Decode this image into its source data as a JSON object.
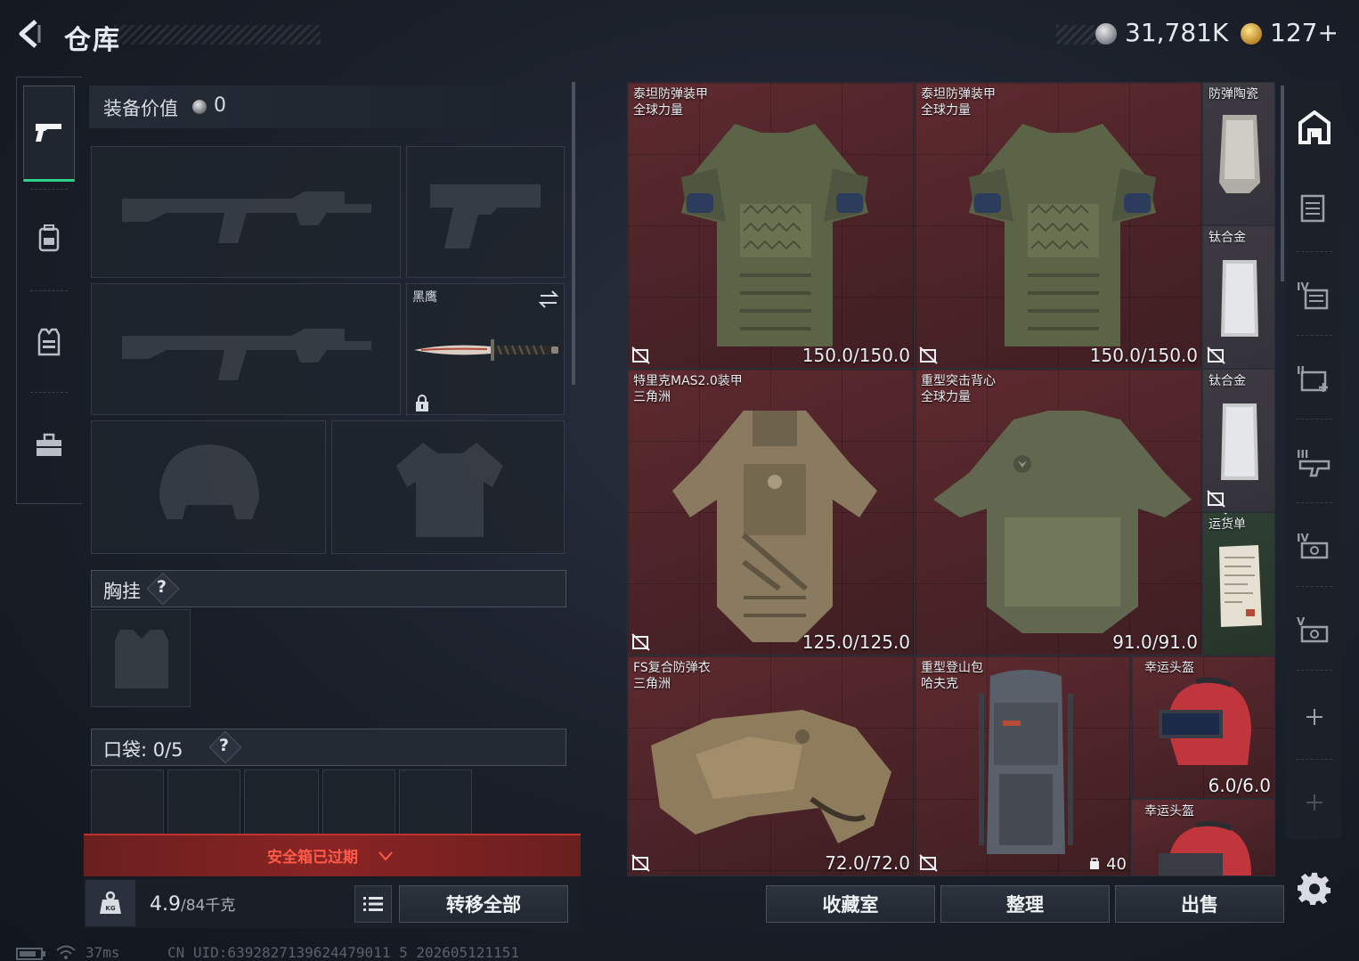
{
  "header": {
    "title": "仓库",
    "silver_amount": "31,781K",
    "gold_amount": "127+"
  },
  "left_nav": {
    "items": [
      {
        "name": "weapons-tab",
        "icon": "pistol-icon",
        "active": true
      },
      {
        "name": "backpack-tab",
        "icon": "backpack-icon",
        "active": false
      },
      {
        "name": "chest-rig-tab",
        "icon": "vest-icon",
        "active": false
      },
      {
        "name": "toolbox-tab",
        "icon": "briefcase-icon",
        "active": false
      }
    ]
  },
  "equipment": {
    "value_label": "装备价值",
    "value": "0",
    "melee_label": "黑鹰",
    "chest_rig_label": "胸挂",
    "chest_rig_help": "?",
    "pockets_label": "口袋: 0/5",
    "pockets_help": "?",
    "safebox_status": "安全箱已过期",
    "weight_current": "4.9",
    "weight_max": "/84千克",
    "transfer_all": "转移全部"
  },
  "storage": {
    "items": [
      {
        "name": "泰坦防弹装甲",
        "sub": "全球力量",
        "durability": "150.0/150.0",
        "color": "red"
      },
      {
        "name": "泰坦防弹装甲",
        "sub": "全球力量",
        "durability": "150.0/150.0",
        "color": "red"
      },
      {
        "name": "防弹陶瓷",
        "sub": "",
        "durability": "",
        "color": "light"
      },
      {
        "name": "钛合金",
        "sub": "",
        "durability": "",
        "color": "light"
      },
      {
        "name": "特里克MAS2.0装甲",
        "sub": "三角洲",
        "durability": "125.0/125.0",
        "color": "red"
      },
      {
        "name": "重型突击背心",
        "sub": "全球力量",
        "durability": "91.0/91.0",
        "color": "red"
      },
      {
        "name": "钛合金",
        "sub": "",
        "durability": "",
        "color": "light"
      },
      {
        "name": "运货单",
        "sub": "",
        "durability": "",
        "color": "green"
      },
      {
        "name": "FS复合防弹衣",
        "sub": "三角洲",
        "durability": "72.0/72.0",
        "color": "red"
      },
      {
        "name": "重型登山包",
        "sub": "哈夫克",
        "durability": "40",
        "color": "red"
      },
      {
        "name": "幸运头盔",
        "sub": "",
        "durability": "6.0/6.0",
        "color": "red"
      },
      {
        "name": "幸运头盔",
        "sub": "",
        "durability": "",
        "color": "red"
      }
    ],
    "buttons": {
      "collection": "收藏室",
      "organize": "整理",
      "sell": "出售"
    }
  },
  "right_nav": {
    "items": [
      "home-icon",
      "armor-plate-icon",
      "iv-armor-icon",
      "add-medkit-icon",
      "iii-armor-icon",
      "iv-weapon-icon",
      "v-weapon-icon",
      "plus-icon",
      "plus-faded-icon"
    ]
  },
  "status_bar": {
    "ping": "37ms",
    "uid": "CN UID:6392827139624479011 5 202605121151"
  },
  "colors": {
    "accent_green": "#2fd28a",
    "cell_red": "#5e2a2f",
    "safebox_red": "#ff5a4a"
  }
}
